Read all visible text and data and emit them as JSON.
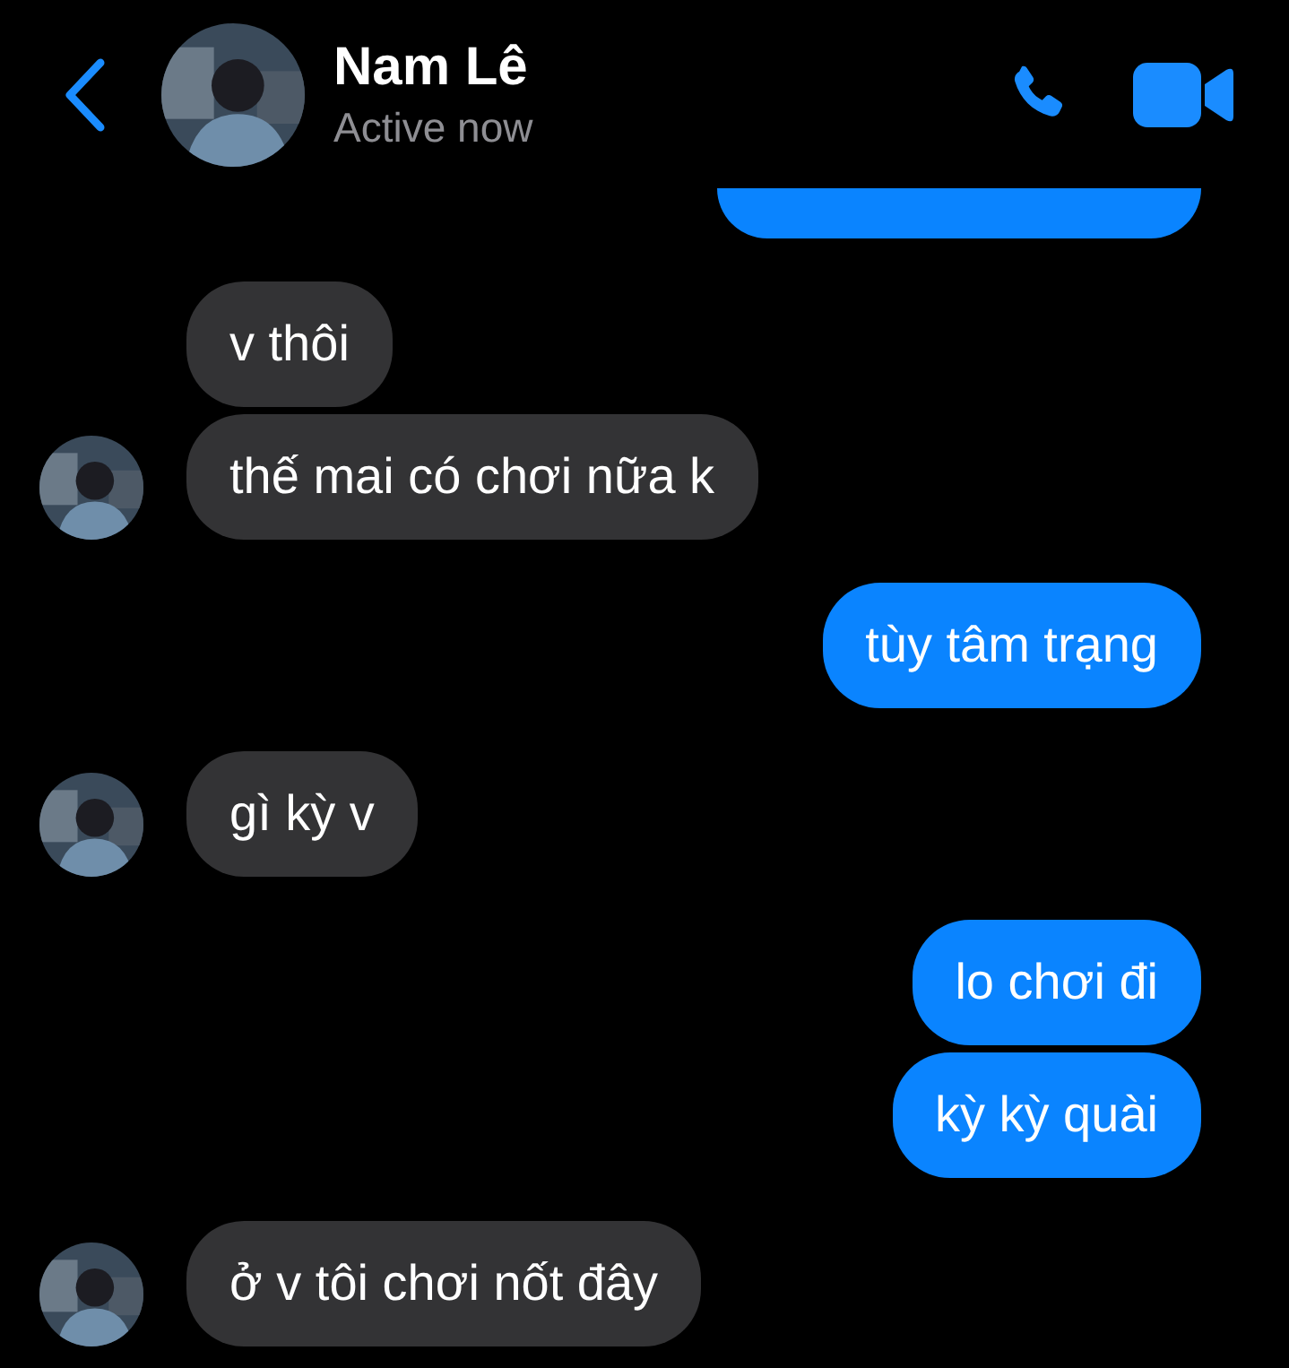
{
  "header": {
    "name": "Nam Lê",
    "status": "Active now"
  },
  "messages": [
    {
      "kind": "sent",
      "clipped": true
    },
    {
      "kind": "received",
      "text": "v thôi",
      "avatar": false
    },
    {
      "kind": "received",
      "text": "thế mai có chơi nữa k",
      "avatar": true
    },
    {
      "kind": "sent",
      "text": "tùy tâm trạng"
    },
    {
      "kind": "received",
      "text": "gì kỳ v",
      "avatar": true
    },
    {
      "kind": "sent",
      "text": "lo chơi đi"
    },
    {
      "kind": "sent",
      "text": "kỳ kỳ quài"
    },
    {
      "kind": "received",
      "text": "ở v tôi chơi nốt đây",
      "avatar": true
    }
  ]
}
